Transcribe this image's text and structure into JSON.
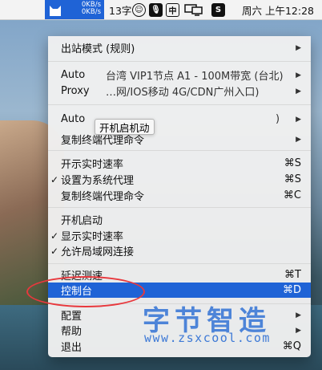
{
  "menubar": {
    "net_up": "0KB/s",
    "net_down": "0KB/s",
    "word_count": "13字",
    "ime_label": "中",
    "s_icon_label": "S",
    "clock": "周六 上午12:28"
  },
  "tooltip": "开机启机动",
  "menu": {
    "outbound_mode": "出站模式 (规则)",
    "auto1_label": "Auto",
    "auto1_value": "台湾 VIP1节点 A1 - 100M带宽 (台北)",
    "proxy_label": "Proxy",
    "proxy_value": "…网/IOS移动 4G/CDN广州入口)",
    "auto2_label": "Auto",
    "auto2_value_suffix": ")",
    "copy_terminal_1": "复制终端代理命令",
    "show_speed": "开示实时速率",
    "show_speed_shortcut": "⌘S",
    "set_system_proxy": "设置为系统代理",
    "set_system_proxy_shortcut": "⌘S",
    "copy_terminal_2": "复制终端代理命令",
    "copy_terminal_2_shortcut": "⌘C",
    "launch_at_login": "开机启动",
    "display_speed": "显示实时速率",
    "allow_lan": "允许局域网连接",
    "latency_test": "延迟测速",
    "latency_test_shortcut": "⌘T",
    "dashboard": "控制台",
    "dashboard_shortcut": "⌘D",
    "config": "配置",
    "help": "帮助",
    "quit": "退出",
    "quit_shortcut": "⌘Q",
    "check_glyph": "✓",
    "submenu_arrow": "▶"
  },
  "watermark": {
    "cn": "字节智造",
    "url": "www.zsxcool.com"
  },
  "colors": {
    "accent": "#1f63d6",
    "ring": "#e8383d",
    "watermark": "#3d79d6"
  }
}
